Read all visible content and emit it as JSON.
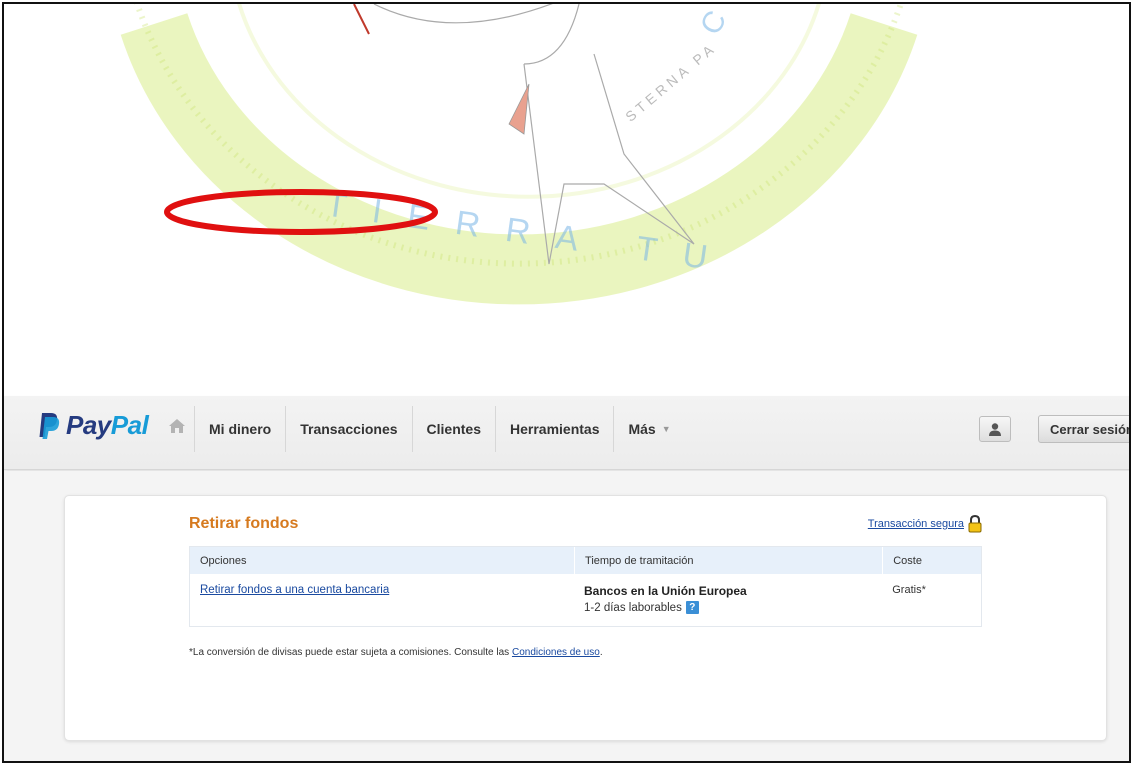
{
  "header": {
    "brand_pay": "Pay",
    "brand_pal": "Pal",
    "nav": [
      {
        "label": "Mi dinero"
      },
      {
        "label": "Transacciones"
      },
      {
        "label": "Clientes"
      },
      {
        "label": "Herramientas"
      },
      {
        "label": "Más"
      }
    ],
    "logout_label": "Cerrar sesión"
  },
  "watermark": {
    "text": "STERNA PA",
    "letters_bottom": "TIERRA TU",
    "letters_right": "COMPARTE"
  },
  "main": {
    "title": "Retirar fondos",
    "secure_label": "Transacción segura",
    "table": {
      "headers": [
        "Opciones",
        "Tiempo de tramitación",
        "Coste"
      ],
      "row": {
        "option_link": "Retirar fondos a una cuenta bancaria",
        "time_title": "Bancos en la Unión Europea",
        "time_detail": "1-2 días laborables",
        "cost": "Gratis*"
      }
    },
    "footnote_text": "*La conversión de divisas puede estar sujeta a comisiones. Consulte las ",
    "footnote_link": "Condiciones de uso",
    "footnote_end": "."
  },
  "colors": {
    "title_orange": "#d67a1f",
    "link_blue": "#1a4aa0",
    "paypal_dark": "#253b80",
    "paypal_light": "#179bd7",
    "annotation_red": "#e01010",
    "watermark_green": "#c9e36b"
  }
}
